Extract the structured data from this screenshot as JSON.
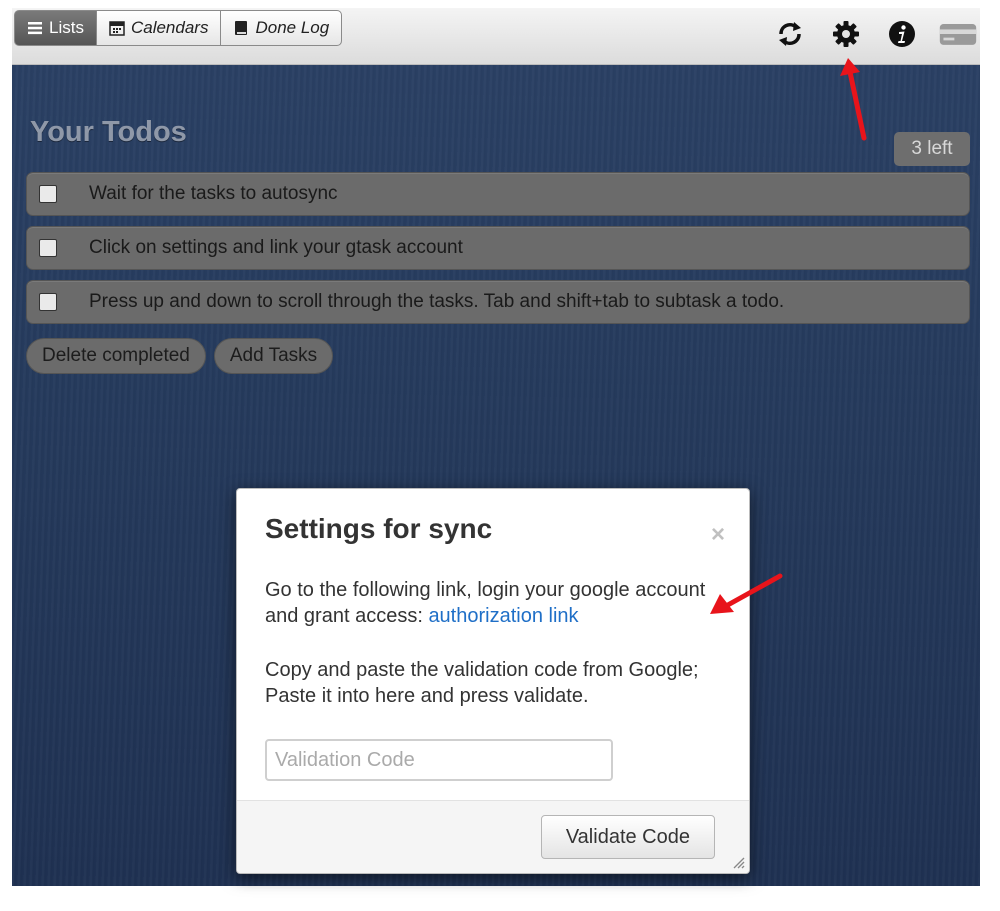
{
  "tabs": [
    {
      "label": "Lists",
      "icon": "list-icon",
      "active": true
    },
    {
      "label": "Calendars",
      "icon": "calendar-icon",
      "active": false
    },
    {
      "label": "Done Log",
      "icon": "book-icon",
      "active": false
    }
  ],
  "toolbar_icons": [
    "sync-icon",
    "gear-icon",
    "info-icon",
    "credit-card-icon"
  ],
  "panel": {
    "title": "Your Todos",
    "count_label": "3 left"
  },
  "todos": [
    {
      "text": "Wait for the tasks to autosync",
      "checked": false
    },
    {
      "text": "Click on settings and link your gtask account",
      "checked": false
    },
    {
      "text": "Press up and down to scroll through the tasks. Tab and shift+tab to subtask a todo.",
      "checked": false
    }
  ],
  "actions": {
    "delete_completed": "Delete completed",
    "add_tasks": "Add Tasks"
  },
  "modal": {
    "title": "Settings for sync",
    "close": "×",
    "instructions": "Go to the following link, login your google account and grant access:",
    "link_text": "authorization link",
    "paste_instructions": "Copy and paste the validation code from Google; Paste it into here and press validate.",
    "input_placeholder": "Validation Code",
    "input_value": "",
    "validate_button": "Validate Code"
  },
  "colors": {
    "background": "#253a5c",
    "todo_bg": "#6b6b6b",
    "link": "#1f6fc7",
    "annotation_arrow": "#e8141b"
  }
}
